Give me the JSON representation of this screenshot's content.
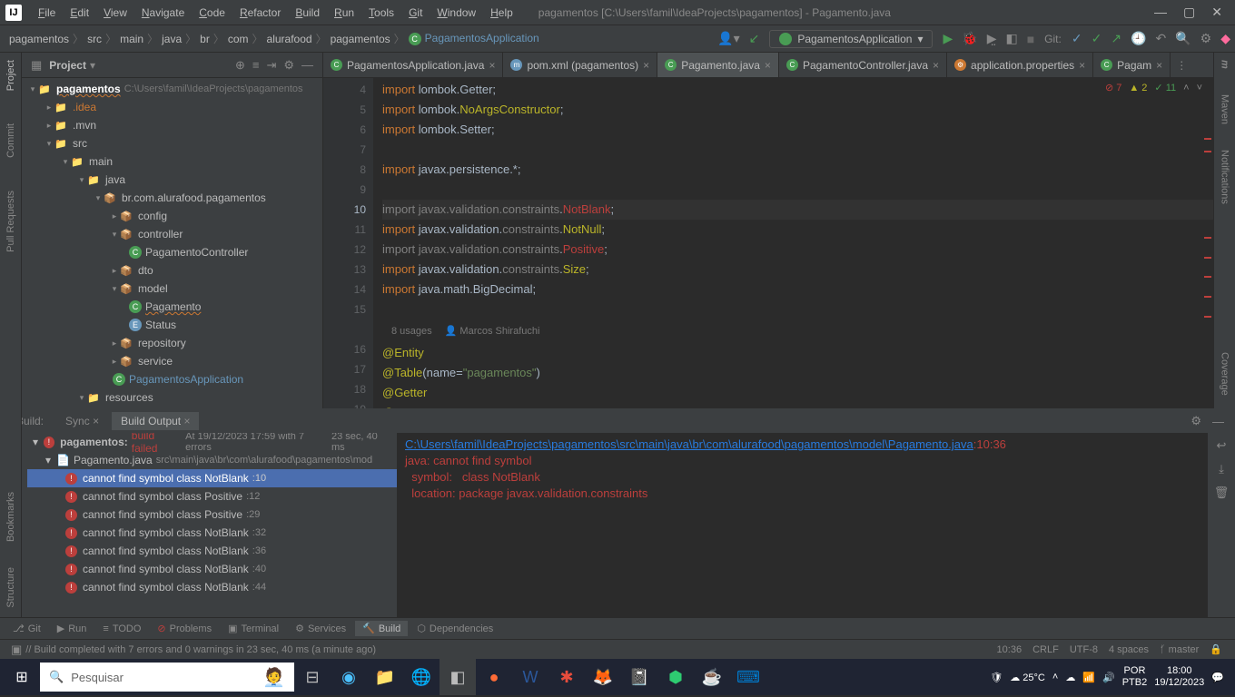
{
  "window": {
    "title": "pagamentos [C:\\Users\\famil\\IdeaProjects\\pagamentos] - Pagamento.java"
  },
  "menu": [
    "File",
    "Edit",
    "View",
    "Navigate",
    "Code",
    "Refactor",
    "Build",
    "Run",
    "Tools",
    "Git",
    "Window",
    "Help"
  ],
  "breadcrumbs": [
    "pagamentos",
    "src",
    "main",
    "java",
    "br",
    "com",
    "alurafood",
    "pagamentos"
  ],
  "breadcrumb_app": "PagamentosApplication",
  "run_config": "PagamentosApplication",
  "vcs_label": "Git:",
  "left_rail": [
    "Project",
    "Commit",
    "Pull Requests"
  ],
  "right_rail": [
    "m",
    "Maven",
    "Notifications"
  ],
  "right_rail_bottom": [
    "Coverage"
  ],
  "left_rail_bottom": [
    "Bookmarks",
    "Structure"
  ],
  "project_panel": {
    "title": "Project"
  },
  "tree": {
    "root": {
      "label": "pagamentos",
      "path": "C:\\Users\\famil\\IdeaProjects\\pagamentos"
    },
    "n_idea": ".idea",
    "n_mvn": ".mvn",
    "n_src": "src",
    "n_main": "main",
    "n_java": "java",
    "n_pkg": "br.com.alurafood.pagamentos",
    "n_config": "config",
    "n_controller": "controller",
    "n_pagctrl": "PagamentoController",
    "n_dto": "dto",
    "n_model": "model",
    "n_pagamento": "Pagamento",
    "n_status": "Status",
    "n_repository": "repository",
    "n_service": "service",
    "n_pagapp": "PagamentosApplication",
    "n_resources": "resources"
  },
  "tabs": [
    {
      "icon": "c",
      "label": "PagamentosApplication.java",
      "active": false
    },
    {
      "icon": "m",
      "label": "pom.xml (pagamentos)",
      "active": false
    },
    {
      "icon": "c",
      "label": "Pagamento.java",
      "active": true
    },
    {
      "icon": "c",
      "label": "PagamentoController.java",
      "active": false
    },
    {
      "icon": "p",
      "label": "application.properties",
      "active": false
    },
    {
      "icon": "c",
      "label": "Pagam",
      "active": false
    }
  ],
  "inspection": {
    "errors": "7",
    "warnings": "2",
    "ok": "11"
  },
  "gutter_start": 4,
  "code_hint": {
    "usages": "8 usages",
    "author": "Marcos Shirafuchi"
  },
  "code_lines": [
    {
      "n": 4,
      "html": "<span class='k'>import</span> <span class='n'>lombok.Getter</span><span class='n'>;</span>"
    },
    {
      "n": 5,
      "html": "<span class='k'>import</span> <span class='n'>lombok.</span><span class='y'>NoArgsConstructor</span><span class='n'>;</span>"
    },
    {
      "n": 6,
      "html": "<span class='k'>import</span> <span class='n'>lombok.Setter</span><span class='n'>;</span>"
    },
    {
      "n": 7,
      "html": ""
    },
    {
      "n": 8,
      "html": "<span class='k'>import</span> <span class='n'>javax.persistence.*</span><span class='n'>;</span>"
    },
    {
      "n": 9,
      "html": ""
    },
    {
      "n": 10,
      "curr": true,
      "html": "<span class='d'>import</span> <span class='d'>javax.validation.</span><span class='d'>constraints</span><span class='n'>.</span><span class='r'>NotBlank</span><span class='n'>;</span>"
    },
    {
      "n": 11,
      "html": "<span class='k'>import</span> <span class='n'>javax.validation.</span><span class='d'>constraints</span><span class='n'>.</span><span class='y'>NotNull</span><span class='n'>;</span>"
    },
    {
      "n": 12,
      "html": "<span class='d'>import</span> <span class='d'>javax.validation.</span><span class='d'>constraints</span><span class='n'>.</span><span class='r'>Positive</span><span class='n'>;</span>"
    },
    {
      "n": 13,
      "html": "<span class='k'>import</span> <span class='n'>javax.validation.</span><span class='d'>constraints</span><span class='n'>.</span><span class='y'>Size</span><span class='n'>;</span>"
    },
    {
      "n": 14,
      "html": "<span class='k'>import</span> <span class='n'>java.math.BigDecimal</span><span class='n'>;</span>"
    },
    {
      "n": 15,
      "html": ""
    },
    {
      "n": 0,
      "hint": true
    },
    {
      "n": 16,
      "html": "<span class='y'>@Entity</span>"
    },
    {
      "n": 17,
      "html": "<span class='y'>@Table</span><span class='n'>(name=</span><span class='s'>\"pagamentos\"</span><span class='n'>)</span>"
    },
    {
      "n": 18,
      "html": "<span class='y'>@Getter</span>"
    },
    {
      "n": 19,
      "html": "<span class='y'>@Setter</span>"
    }
  ],
  "build": {
    "tabs": [
      "Build:",
      "Sync",
      "Build Output"
    ],
    "active_tab": 2,
    "root": {
      "label": "pagamentos:",
      "status": "build failed",
      "meta": "At 19/12/2023 17:59 with 7 errors",
      "time": "23 sec, 40 ms"
    },
    "file": {
      "label": "Pagamento.java",
      "path": "src\\main\\java\\br\\com\\alurafood\\pagamentos\\mod"
    },
    "errors": [
      {
        "msg": "cannot find symbol class NotBlank",
        "loc": ":10",
        "sel": true
      },
      {
        "msg": "cannot find symbol class Positive",
        "loc": ":12"
      },
      {
        "msg": "cannot find symbol class Positive",
        "loc": ":29"
      },
      {
        "msg": "cannot find symbol class NotBlank",
        "loc": ":32"
      },
      {
        "msg": "cannot find symbol class NotBlank",
        "loc": ":36"
      },
      {
        "msg": "cannot find symbol class NotBlank",
        "loc": ":40"
      },
      {
        "msg": "cannot find symbol class NotBlank",
        "loc": ":44"
      }
    ],
    "output": {
      "path": "C:\\Users\\famil\\IdeaProjects\\pagamentos\\src\\main\\java\\br\\com\\alurafood\\pagamentos\\model\\Pagamento.java",
      "loc": ":10:36",
      "l1": "java: cannot find symbol",
      "l2": "  symbol:   class NotBlank",
      "l3": "  location: package javax.validation.constraints"
    }
  },
  "toolwin": [
    {
      "icon": "⎇",
      "label": "Git"
    },
    {
      "icon": "▶",
      "label": "Run"
    },
    {
      "icon": "≡",
      "label": "TODO"
    },
    {
      "icon": "⊘",
      "label": "Problems",
      "warn": true
    },
    {
      "icon": "▣",
      "label": "Terminal"
    },
    {
      "icon": "⚙",
      "label": "Services"
    },
    {
      "icon": "🔨",
      "label": "Build",
      "active": true
    },
    {
      "icon": "⬡",
      "label": "Dependencies"
    }
  ],
  "status": {
    "msg": "// Build completed with 7 errors and 0 warnings in 23 sec, 40 ms (a minute ago)",
    "pos": "10:36",
    "eol": "CRLF",
    "enc": "UTF-8",
    "indent": "4 spaces",
    "branch": "master"
  },
  "taskbar": {
    "search": "Pesquisar",
    "weather": "25°C",
    "lang1": "POR",
    "lang2": "PTB2",
    "time": "18:00",
    "date": "19/12/2023"
  }
}
